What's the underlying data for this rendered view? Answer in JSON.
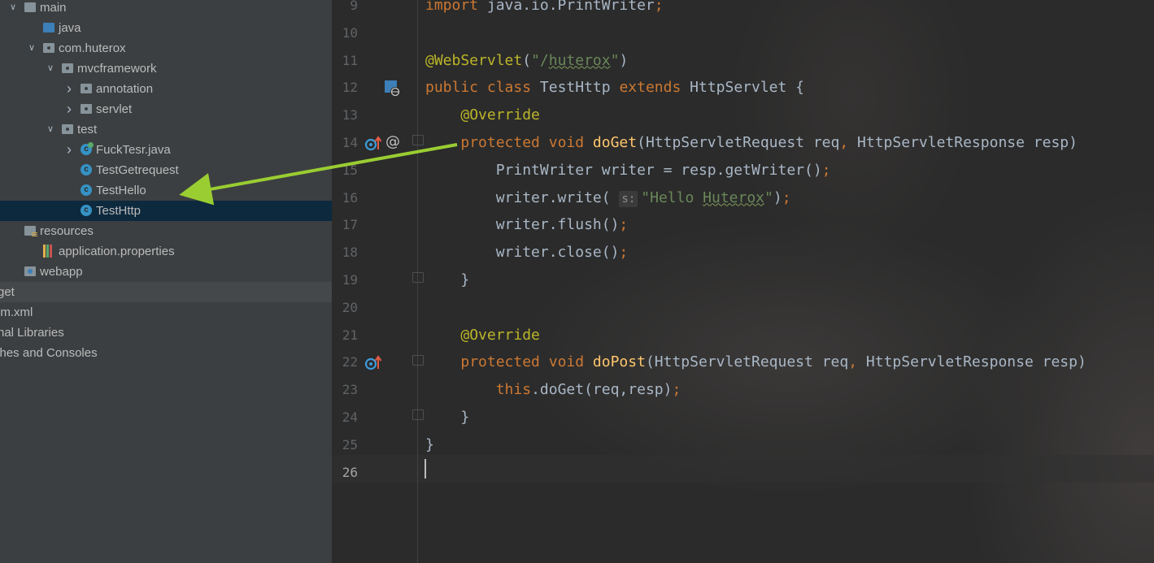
{
  "project_tree": {
    "items": [
      {
        "label": "main",
        "indent": 0,
        "icon": "folder-icon",
        "chevron": "expanded"
      },
      {
        "label": "java",
        "indent": 1,
        "icon": "source-folder-icon",
        "chevron": ""
      },
      {
        "label": "com.huterox",
        "indent": 1,
        "icon": "package-icon",
        "chevron": "expanded"
      },
      {
        "label": "mvcframework",
        "indent": 2,
        "icon": "package-icon",
        "chevron": "expanded"
      },
      {
        "label": "annotation",
        "indent": 3,
        "icon": "package-icon",
        "chevron": "collapsed"
      },
      {
        "label": "servlet",
        "indent": 3,
        "icon": "package-icon",
        "chevron": "collapsed"
      },
      {
        "label": "test",
        "indent": 2,
        "icon": "package-icon",
        "chevron": "expanded"
      },
      {
        "label": "FuckTesr.java",
        "indent": 3,
        "icon": "runnable-class-icon",
        "chevron": "collapsed"
      },
      {
        "label": "TestGetrequest",
        "indent": 3,
        "icon": "class-icon",
        "chevron": ""
      },
      {
        "label": "TestHello",
        "indent": 3,
        "icon": "class-icon",
        "chevron": ""
      },
      {
        "label": "TestHttp",
        "indent": 3,
        "icon": "class-icon",
        "chevron": "",
        "selected": true
      },
      {
        "label": "resources",
        "indent": 0,
        "icon": "resources-folder-icon",
        "chevron": ""
      },
      {
        "label": "application.properties",
        "indent": 1,
        "icon": "properties-file-icon",
        "chevron": ""
      },
      {
        "label": "webapp",
        "indent": 0,
        "icon": "web-folder-icon",
        "chevron": ""
      },
      {
        "label": "rget",
        "indent": -1,
        "icon": "",
        "chevron": "",
        "highlight": true
      },
      {
        "label": "om.xml",
        "indent": -1,
        "icon": "",
        "chevron": ""
      },
      {
        "label": "rnal Libraries",
        "indent": -1,
        "icon": "",
        "chevron": ""
      },
      {
        "label": "ches and Consoles",
        "indent": -1,
        "icon": "",
        "chevron": ""
      }
    ]
  },
  "editor": {
    "file": "TestHttp",
    "current_line": 26,
    "lines": [
      {
        "n": "9",
        "tokens": [
          [
            "kw",
            "import "
          ],
          [
            "",
            "java.io.PrintWriter"
          ],
          [
            "kw",
            ";"
          ]
        ]
      },
      {
        "n": "10",
        "tokens": []
      },
      {
        "n": "11",
        "tokens": [
          [
            "ann",
            "@WebServlet"
          ],
          [
            "",
            "("
          ],
          [
            "str",
            "\"/"
          ],
          [
            "str sq",
            "huterox"
          ],
          [
            "str",
            "\""
          ],
          [
            "",
            ")"
          ]
        ]
      },
      {
        "n": "12",
        "tokens": [
          [
            "kw",
            "public class "
          ],
          [
            "",
            "TestHttp "
          ],
          [
            "kw",
            "extends "
          ],
          [
            "",
            "HttpServlet {"
          ]
        ]
      },
      {
        "n": "13",
        "tokens": [
          [
            "",
            "    "
          ],
          [
            "ann",
            "@Override"
          ]
        ]
      },
      {
        "n": "14",
        "tokens": [
          [
            "",
            "    "
          ],
          [
            "kw",
            "protected void "
          ],
          [
            "fn",
            "doGet"
          ],
          [
            "",
            "(HttpServletRequest req"
          ],
          [
            "kw",
            ", "
          ],
          [
            "",
            "HttpServletResponse resp)"
          ]
        ]
      },
      {
        "n": "15",
        "tokens": [
          [
            "",
            "        PrintWriter writer = resp.getWriter()"
          ],
          [
            "kw",
            ";"
          ]
        ]
      },
      {
        "n": "16",
        "tokens": [
          [
            "",
            "        writer.write( "
          ],
          [
            "hint",
            "s:"
          ],
          [
            "str",
            "\"Hello "
          ],
          [
            "str sq",
            "Huterox"
          ],
          [
            "str",
            "\""
          ],
          [
            "",
            ")"
          ],
          [
            "kw",
            ";"
          ]
        ]
      },
      {
        "n": "17",
        "tokens": [
          [
            "",
            "        writer.flush()"
          ],
          [
            "kw",
            ";"
          ]
        ]
      },
      {
        "n": "18",
        "tokens": [
          [
            "",
            "        writer.close()"
          ],
          [
            "kw",
            ";"
          ]
        ]
      },
      {
        "n": "19",
        "tokens": [
          [
            "",
            "    }"
          ]
        ]
      },
      {
        "n": "20",
        "tokens": []
      },
      {
        "n": "21",
        "tokens": [
          [
            "",
            "    "
          ],
          [
            "ann",
            "@Override"
          ]
        ]
      },
      {
        "n": "22",
        "tokens": [
          [
            "",
            "    "
          ],
          [
            "kw",
            "protected void "
          ],
          [
            "fn",
            "doPost"
          ],
          [
            "",
            "(HttpServletRequest req"
          ],
          [
            "kw",
            ", "
          ],
          [
            "",
            "HttpServletResponse resp)"
          ]
        ]
      },
      {
        "n": "23",
        "tokens": [
          [
            "",
            "        "
          ],
          [
            "kw",
            "this"
          ],
          [
            "",
            ".doGet(req,resp)"
          ],
          [
            "kw",
            ";"
          ]
        ]
      },
      {
        "n": "24",
        "tokens": [
          [
            "",
            "    }"
          ]
        ]
      },
      {
        "n": "25",
        "tokens": [
          [
            "",
            "}"
          ]
        ]
      },
      {
        "n": "26",
        "tokens": []
      }
    ],
    "gutter_markers": {
      "12": [
        "web-servlet-icon"
      ],
      "14": [
        "override-method-icon",
        "annotation-at-icon"
      ],
      "22": [
        "override-method-icon"
      ]
    }
  },
  "annotation_arrow": {
    "color": "#9acd32"
  }
}
